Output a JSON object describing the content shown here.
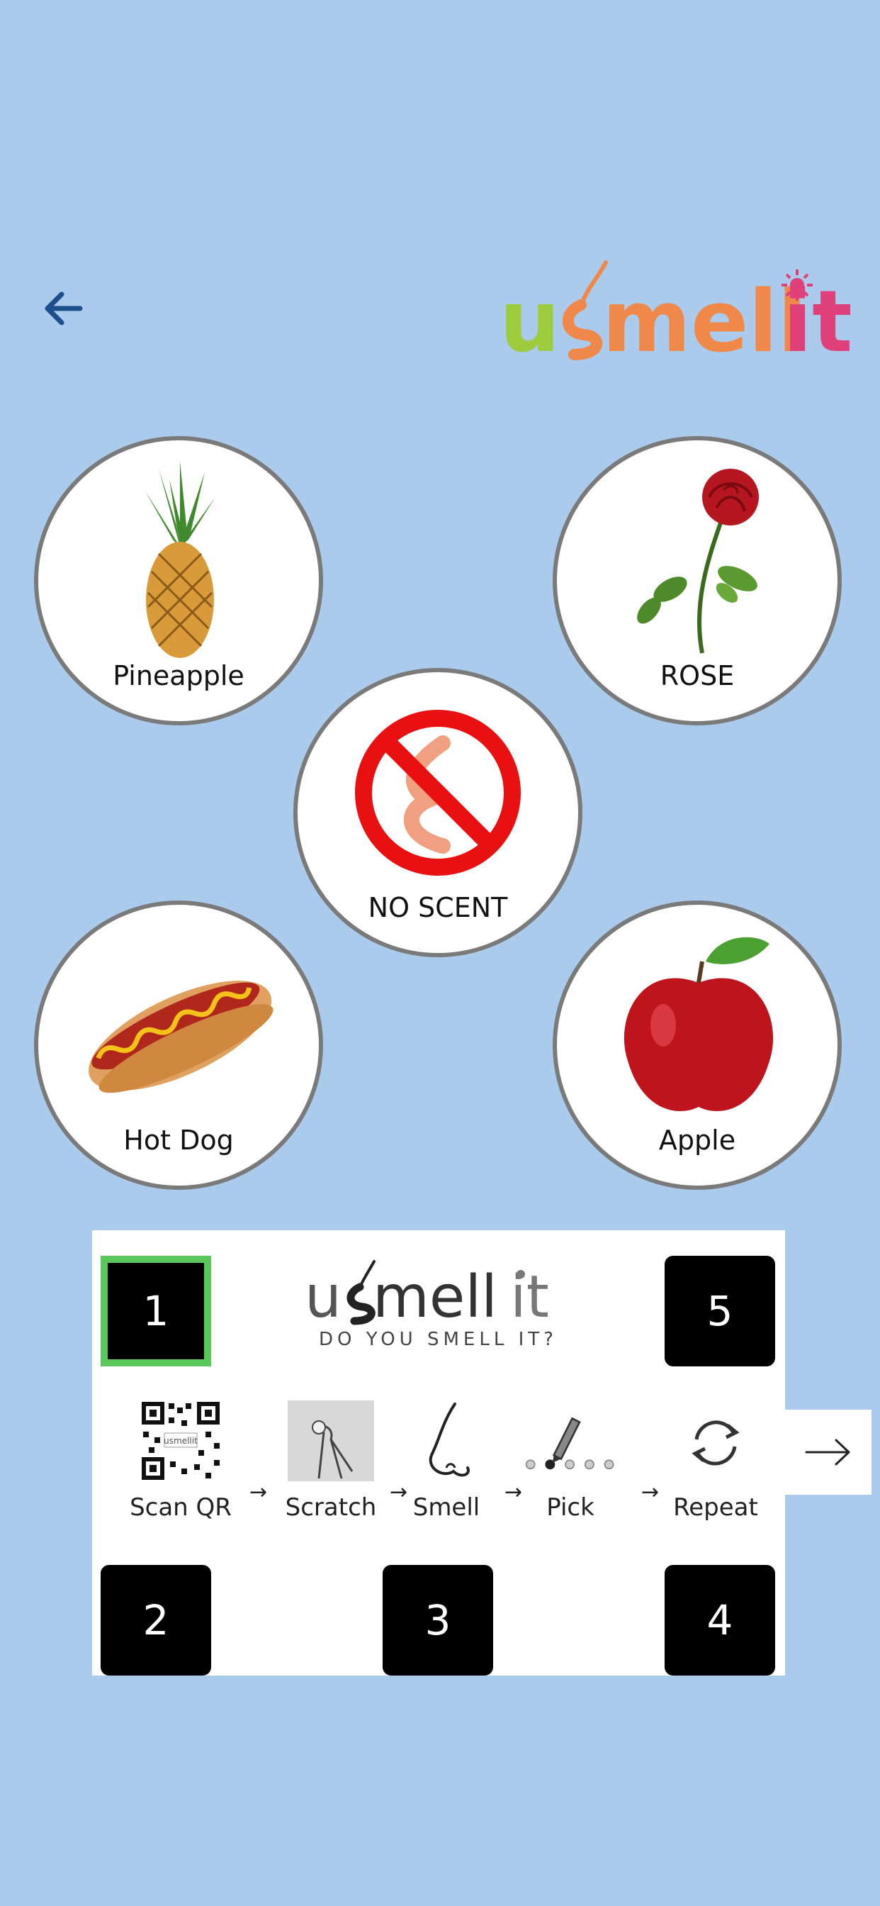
{
  "header": {
    "back_icon": "arrow-left-icon",
    "logo_text": "usmellit"
  },
  "choices": [
    {
      "label": "Pineapple",
      "icon": "pineapple-image"
    },
    {
      "label": "ROSE",
      "icon": "rose-image"
    },
    {
      "label": "NO SCENT",
      "icon": "no-scent-icon"
    },
    {
      "label": "Hot Dog",
      "icon": "hot-dog-image"
    },
    {
      "label": "Apple",
      "icon": "apple-image"
    }
  ],
  "instructions": {
    "logo_text": "usmellit",
    "tagline": "DO YOU SMELL IT?",
    "boxes": [
      "1",
      "5",
      "2",
      "3",
      "4"
    ],
    "active_box": "1",
    "steps": [
      {
        "label": "Scan QR",
        "icon": "qr-code-icon"
      },
      {
        "label": "Scratch",
        "icon": "scratch-hand-icon"
      },
      {
        "label": "Smell",
        "icon": "nose-icon"
      },
      {
        "label": "Pick",
        "icon": "pick-pencil-icon"
      },
      {
        "label": "Repeat",
        "icon": "repeat-icon"
      }
    ],
    "arrow_glyph": "→"
  },
  "next_button": {
    "icon": "arrow-right-icon"
  },
  "colors": {
    "background": "#abcbec",
    "circle_border": "#7a7a7a",
    "active_box_border": "#5ac85a",
    "logo_green": "#9ccb3b",
    "logo_orange": "#f0884a",
    "logo_pink": "#e0407a",
    "back_arrow": "#1d4f8c"
  }
}
